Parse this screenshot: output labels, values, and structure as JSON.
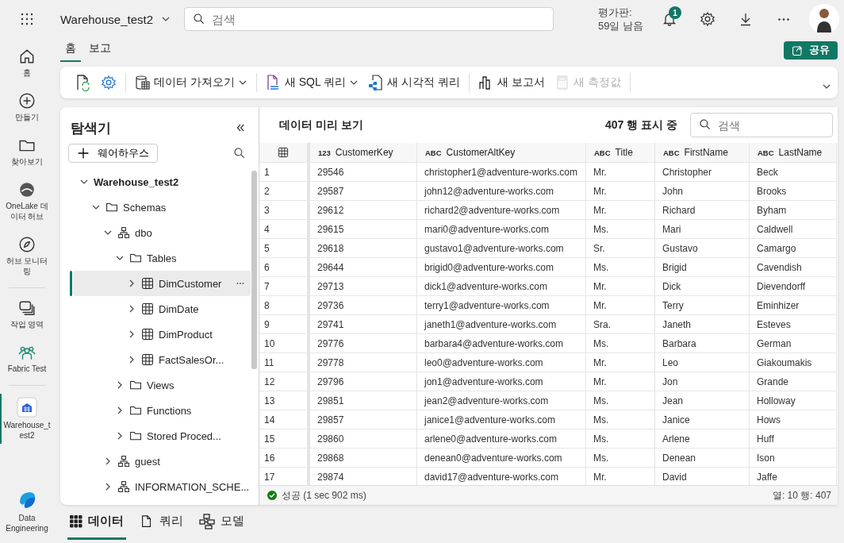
{
  "top_bar": {
    "workspace": "Warehouse_test2",
    "search": {
      "placeholder": "검색"
    },
    "trial": {
      "label": "평가판:",
      "days_left": "59일 남음"
    },
    "notifications": {
      "count": "1"
    }
  },
  "rail": {
    "sections": [
      [
        {
          "kind": "home",
          "label": "홈",
          "selected": false
        },
        {
          "kind": "create",
          "label": "만들기",
          "selected": false
        },
        {
          "kind": "browse",
          "label": "찾아보기",
          "selected": false
        },
        {
          "kind": "onelake",
          "label": "OneLake 데이터 허브",
          "selected": false
        },
        {
          "kind": "monitor",
          "label": "허브 모니터링",
          "selected": false
        }
      ],
      [
        {
          "kind": "workspaces",
          "label": "작업 영역",
          "selected": false
        },
        {
          "kind": "people",
          "label": "Fabric Test",
          "selected": false
        }
      ],
      [
        {
          "kind": "warehouse",
          "label": "Warehouse_test2",
          "selected": true
        }
      ]
    ],
    "footer": {
      "kind": "engineering",
      "label": "Data Engineering"
    }
  },
  "ribbon": {
    "tabs": [
      {
        "label": "홈",
        "selected": true
      },
      {
        "label": "보고",
        "selected": false
      }
    ],
    "share": "공유",
    "groups": [
      [
        {
          "kind": "refresh",
          "dropdown": false,
          "disabled": false
        },
        {
          "kind": "settings",
          "dropdown": false,
          "disabled": false
        }
      ],
      [
        {
          "kind": "get-data",
          "label": "데이터 가져오기",
          "dropdown": true,
          "disabled": false
        }
      ],
      [
        {
          "kind": "sql-query",
          "label": "새 SQL 쿼리",
          "dropdown": true,
          "disabled": false
        },
        {
          "kind": "visual-query",
          "label": "새 시각적 쿼리",
          "dropdown": false,
          "disabled": false
        }
      ],
      [
        {
          "kind": "report",
          "label": "새 보고서",
          "dropdown": false,
          "disabled": false
        },
        {
          "kind": "measure",
          "label": "새 측정값",
          "dropdown": false,
          "disabled": true
        }
      ]
    ]
  },
  "explorer": {
    "title": "탐색기",
    "add_button": "웨어하우스",
    "tree": [
      {
        "kind": "warehouse",
        "label": "Warehouse_test2",
        "expanded": true,
        "selected": false,
        "children": [
          {
            "kind": "folder",
            "label": "Schemas",
            "expanded": true,
            "selected": false,
            "children": [
              {
                "kind": "schema",
                "label": "dbo",
                "expanded": true,
                "selected": false,
                "children": [
                  {
                    "kind": "folder",
                    "label": "Tables",
                    "expanded": true,
                    "selected": false,
                    "children": [
                      {
                        "kind": "table",
                        "label": "DimCustomer",
                        "expanded": false,
                        "selected": true
                      },
                      {
                        "kind": "table",
                        "label": "DimDate",
                        "expanded": false,
                        "selected": false
                      },
                      {
                        "kind": "table",
                        "label": "DimProduct",
                        "expanded": false,
                        "selected": false
                      },
                      {
                        "kind": "table",
                        "label": "FactSalesOr...",
                        "expanded": false,
                        "selected": false
                      }
                    ]
                  },
                  {
                    "kind": "folder",
                    "label": "Views",
                    "expanded": false,
                    "selected": false
                  },
                  {
                    "kind": "folder",
                    "label": "Functions",
                    "expanded": false,
                    "selected": false
                  },
                  {
                    "kind": "folder",
                    "label": "Stored Proced...",
                    "expanded": false,
                    "selected": false
                  }
                ]
              },
              {
                "kind": "schema",
                "label": "guest",
                "expanded": false,
                "selected": false
              },
              {
                "kind": "schema",
                "label": "INFORMATION_SCHE...",
                "expanded": false,
                "selected": false
              }
            ]
          }
        ]
      }
    ]
  },
  "preview": {
    "title": "데이터 미리 보기",
    "row_count": "407 행 표시 중",
    "search": {
      "placeholder": "검색"
    },
    "table": {
      "columns": [
        {
          "kind": "row-number"
        },
        {
          "kind": "field",
          "type": "123",
          "name": "CustomerKey"
        },
        {
          "kind": "field",
          "type": "ABC",
          "name": "CustomerAltKey"
        },
        {
          "kind": "field",
          "type": "ABC",
          "name": "Title"
        },
        {
          "kind": "field",
          "type": "ABC",
          "name": "FirstName"
        },
        {
          "kind": "field",
          "type": "ABC",
          "name": "LastName"
        }
      ],
      "rows": [
        [
          "1",
          "29546",
          "christopher1@adventure-works.com",
          "Mr.",
          "Christopher",
          "Beck"
        ],
        [
          "2",
          "29587",
          "john12@adventure-works.com",
          "Mr.",
          "John",
          "Brooks"
        ],
        [
          "3",
          "29612",
          "richard2@adventure-works.com",
          "Mr.",
          "Richard",
          "Byham"
        ],
        [
          "4",
          "29615",
          "mari0@adventure-works.com",
          "Ms.",
          "Mari",
          "Caldwell"
        ],
        [
          "5",
          "29618",
          "gustavo1@adventure-works.com",
          "Sr.",
          "Gustavo",
          "Camargo"
        ],
        [
          "6",
          "29644",
          "brigid0@adventure-works.com",
          "Ms.",
          "Brigid",
          "Cavendish"
        ],
        [
          "7",
          "29713",
          "dick1@adventure-works.com",
          "Mr.",
          "Dick",
          "Dievendorff"
        ],
        [
          "8",
          "29736",
          "terry1@adventure-works.com",
          "Mr.",
          "Terry",
          "Eminhizer"
        ],
        [
          "9",
          "29741",
          "janeth1@adventure-works.com",
          "Sra.",
          "Janeth",
          "Esteves"
        ],
        [
          "10",
          "29776",
          "barbara4@adventure-works.com",
          "Ms.",
          "Barbara",
          "German"
        ],
        [
          "11",
          "29778",
          "leo0@adventure-works.com",
          "Mr.",
          "Leo",
          "Giakoumakis"
        ],
        [
          "12",
          "29796",
          "jon1@adventure-works.com",
          "Mr.",
          "Jon",
          "Grande"
        ],
        [
          "13",
          "29851",
          "jean2@adventure-works.com",
          "Ms.",
          "Jean",
          "Holloway"
        ],
        [
          "14",
          "29857",
          "janice1@adventure-works.com",
          "Ms.",
          "Janice",
          "Hows"
        ],
        [
          "15",
          "29860",
          "arlene0@adventure-works.com",
          "Ms.",
          "Arlene",
          "Huff"
        ],
        [
          "16",
          "29868",
          "denean0@adventure-works.com",
          "Ms.",
          "Denean",
          "Ison"
        ],
        [
          "17",
          "29874",
          "david17@adventure-works.com",
          "Mr.",
          "David",
          "Jaffe"
        ]
      ]
    },
    "status": {
      "message": "성공 (1 sec 902 ms)",
      "summary": "열: 10 행: 407"
    }
  },
  "bottom_tabs": [
    {
      "kind": "data",
      "label": "데이터",
      "selected": true
    },
    {
      "kind": "query",
      "label": "쿼리",
      "selected": false
    },
    {
      "kind": "model",
      "label": "모델",
      "selected": false
    }
  ]
}
